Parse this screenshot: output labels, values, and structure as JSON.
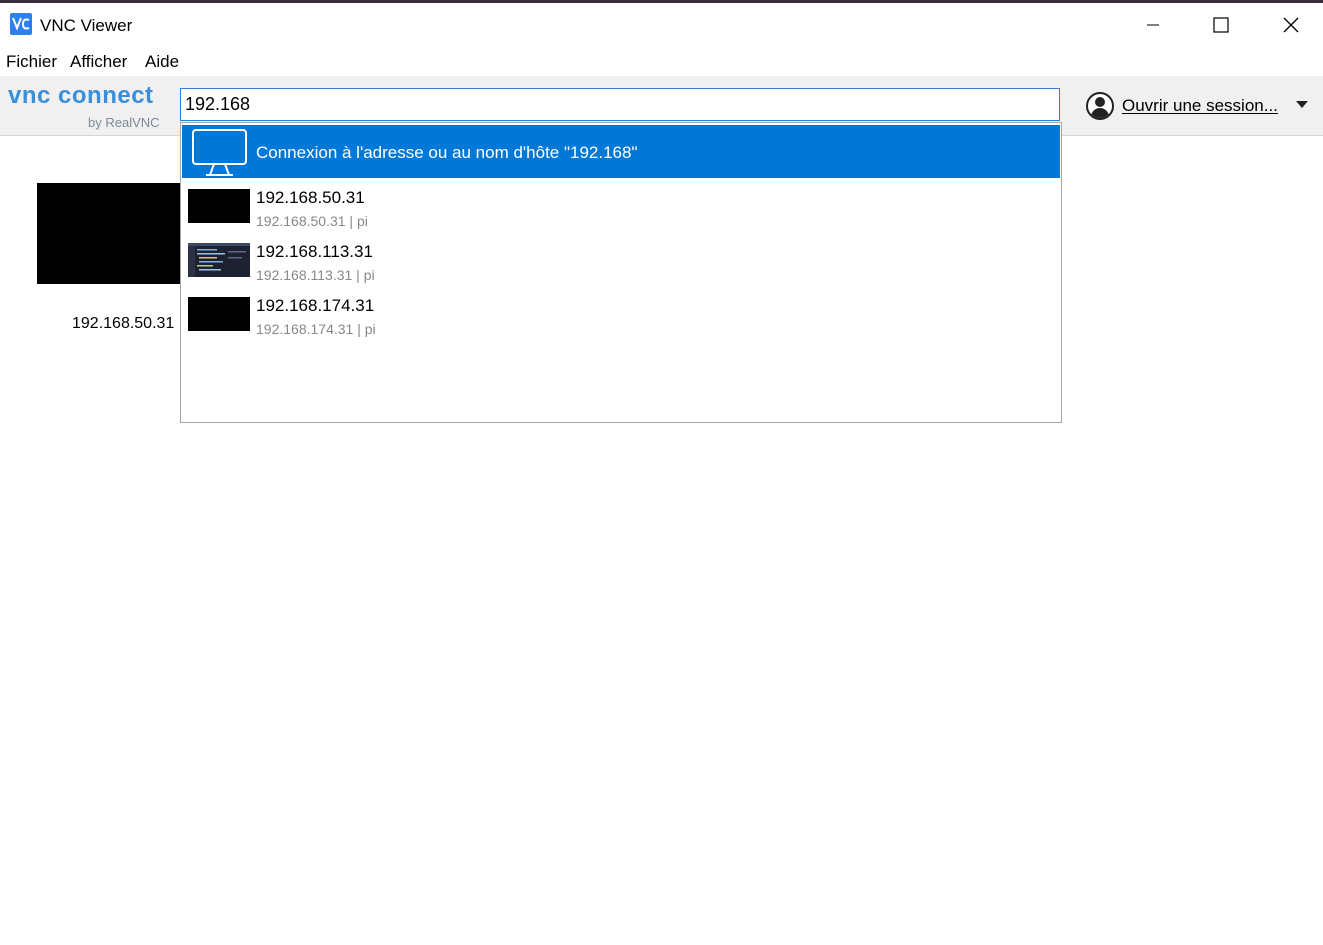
{
  "window": {
    "title": "VNC Viewer"
  },
  "menu": {
    "items": [
      "Fichier",
      "Afficher",
      "Aide"
    ]
  },
  "logo": {
    "main": "vnc connect",
    "sub": "by RealVNC"
  },
  "search": {
    "value": "192.168"
  },
  "signin": {
    "label": "Ouvrir une session..."
  },
  "background_entry": {
    "label": "192.168.50.31"
  },
  "dropdown": {
    "connect_label": "Connexion à l'adresse ou au nom d'hôte \"192.168\"",
    "results": [
      {
        "title": "192.168.50.31",
        "subtitle": "192.168.50.31 | pi",
        "thumb": "black"
      },
      {
        "title": "192.168.113.31",
        "subtitle": "192.168.113.31 | pi",
        "thumb": "code"
      },
      {
        "title": "192.168.174.31",
        "subtitle": "192.168.174.31 | pi",
        "thumb": "black"
      }
    ]
  },
  "colors": {
    "accent": "#0078d7",
    "logo": "#3a8fd8",
    "toolbar_bg": "#f0f0f0"
  },
  "icons": [
    "vnc-app-icon",
    "minimize-icon",
    "maximize-icon",
    "close-icon",
    "user-avatar-icon",
    "dropdown-caret-icon",
    "monitor-icon"
  ]
}
